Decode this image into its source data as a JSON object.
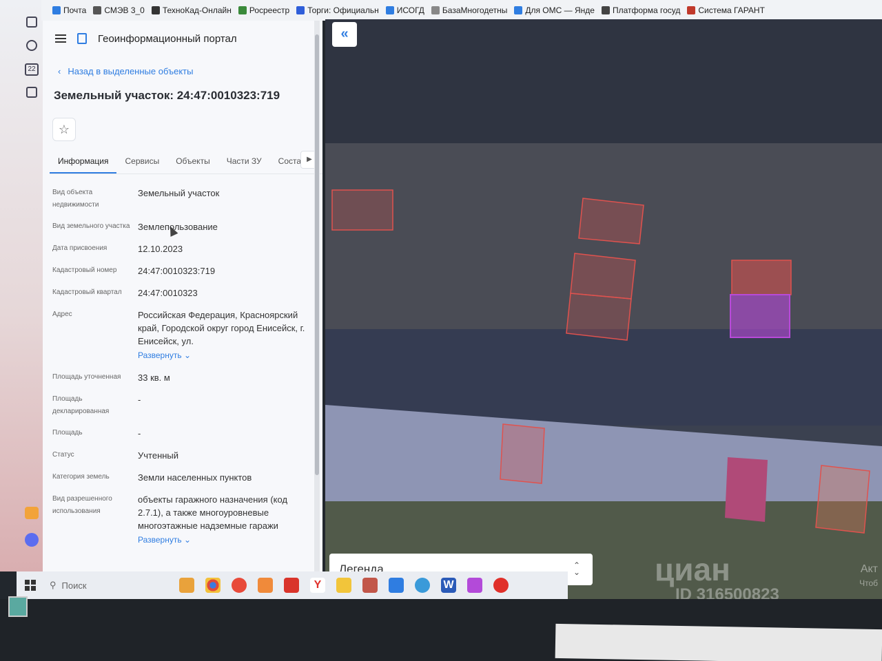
{
  "bookmarks": [
    {
      "label": "Почта",
      "color": "#2f7de1"
    },
    {
      "label": "СМЭВ 3_0",
      "color": "#555555"
    },
    {
      "label": "ТехноКад-Онлайн",
      "color": "#333333"
    },
    {
      "label": "Росреестр",
      "color": "#3a8a3a"
    },
    {
      "label": "Торги: Официальн",
      "color": "#2f5ed9"
    },
    {
      "label": "ИСОГД",
      "color": "#2f7de1"
    },
    {
      "label": "БазаМногодетны",
      "color": "#888888"
    },
    {
      "label": "Для ОМС — Янде",
      "color": "#2f7de1"
    },
    {
      "label": "Платформа госуд",
      "color": "#444444"
    },
    {
      "label": "Система ГАРАНТ",
      "color": "#c0392b"
    }
  ],
  "sysbar": {
    "badge": "22"
  },
  "header": {
    "title": "Геоинформационный портал"
  },
  "nav": {
    "back_label": "Назад в выделенные объекты"
  },
  "object": {
    "title": "Земельный участок: 24:47:0010323:719"
  },
  "tabs": [
    "Информация",
    "Сервисы",
    "Объекты",
    "Части ЗУ",
    "Соста"
  ],
  "info": {
    "rows": [
      {
        "label": "Вид объекта недвижимости",
        "value": "Земельный участок"
      },
      {
        "label": "Вид земельного участка",
        "value": "Землепользование"
      },
      {
        "label": "Дата присвоения",
        "value": "12.10.2023"
      },
      {
        "label": "Кадастровый номер",
        "value": "24:47:0010323:719"
      },
      {
        "label": "Кадастровый квартал",
        "value": "24:47:0010323"
      },
      {
        "label": "Адрес",
        "value": "Российская Федерация, Красноярский край, Городской округ город Енисейск, г. Енисейск, ул."
      },
      {
        "label": "Площадь уточненная",
        "value": "33 кв. м"
      },
      {
        "label": "Площадь декларированная",
        "value": "-"
      },
      {
        "label": "Площадь",
        "value": "-"
      },
      {
        "label": "Статус",
        "value": "Учтенный"
      },
      {
        "label": "Категория земель",
        "value": "Земли населенных пунктов"
      },
      {
        "label": "Вид разрешенного использования",
        "value": "объекты гаражного назначения (код 2.7.1), а также многоуровневые многоэтажные надземные гаражи"
      }
    ],
    "expand_label": "Развернуть"
  },
  "map": {
    "collapse_icon": "«",
    "legend_label": "Легенда",
    "watermark": "циан",
    "watermark_id": "ID 316500823",
    "activation_text": "Акт",
    "activation_sub": "Чтоб"
  },
  "taskbar": {
    "search_placeholder": "Поиск"
  },
  "colors": {
    "accent": "#2f7de1",
    "parcel_outline": "#e0524e",
    "parcel_selected": "#b84ad9"
  }
}
